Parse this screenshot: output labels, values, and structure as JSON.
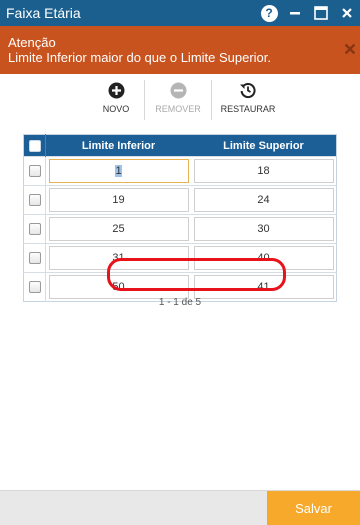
{
  "window": {
    "title": "Faixa Etária"
  },
  "alert": {
    "title": "Atenção",
    "message": "Limite Inferior maior do que o Limite Superior."
  },
  "toolbar": {
    "novo": "NOVO",
    "remover": "REMOVER",
    "restaurar": "RESTAURAR"
  },
  "grid": {
    "columns": [
      "Limite Inferior",
      "Limite Superior"
    ],
    "rows": [
      {
        "inferior": "1",
        "superior": "18"
      },
      {
        "inferior": "19",
        "superior": "24"
      },
      {
        "inferior": "25",
        "superior": "30"
      },
      {
        "inferior": "31",
        "superior": "40"
      },
      {
        "inferior": "50",
        "superior": "41"
      }
    ]
  },
  "pager": {
    "text": "1 - 1 de 5"
  },
  "footer": {
    "save_label": "Salvar"
  },
  "colors": {
    "titlebar": "#1b5f8f",
    "alert": "#c9531f",
    "header": "#1c5f97",
    "save": "#f6a92b",
    "highlight": "#e8121a"
  }
}
